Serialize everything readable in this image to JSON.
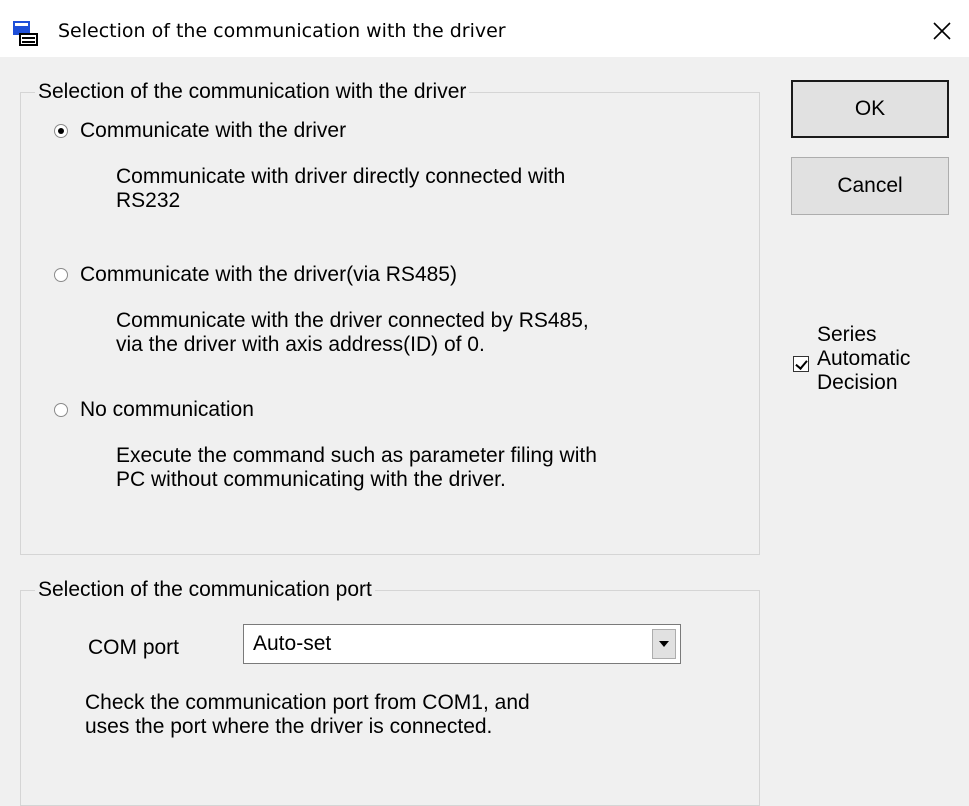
{
  "window": {
    "title": "Selection of the communication with the driver",
    "close_icon": "close-icon",
    "app_icon": "app-icon"
  },
  "driver_group": {
    "legend": "Selection of the communication with the driver",
    "options": [
      {
        "label": "Communicate with the driver",
        "checked": true,
        "description": "Communicate with driver directly connected with\nRS232"
      },
      {
        "label": "Communicate with the driver(via RS485)",
        "checked": false,
        "description": "Communicate with the driver connected by RS485,\nvia the driver with axis address(ID) of 0."
      },
      {
        "label": "No communication",
        "checked": false,
        "description": "Execute the command such as parameter filing with\nPC without communicating with the driver."
      }
    ]
  },
  "buttons": {
    "ok": "OK",
    "cancel": "Cancel"
  },
  "series": {
    "label": "Series\nAutomatic\nDecision",
    "checked": true
  },
  "port_group": {
    "legend": "Selection of the communication port",
    "com_label": "COM port",
    "selected": "Auto-set",
    "description": "Check the communication port from COM1, and\nuses the port where the driver is connected."
  },
  "colors": {
    "background": "#f0f0f0",
    "titlebar": "#ffffff",
    "group_border": "#d5d5d5",
    "button_face": "#e1e1e1"
  }
}
